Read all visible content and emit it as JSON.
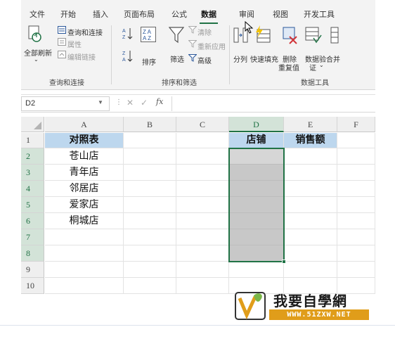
{
  "ribbon": {
    "tabs": [
      {
        "label": "文件",
        "active": false
      },
      {
        "label": "开始",
        "active": false
      },
      {
        "label": "插入",
        "active": false
      },
      {
        "label": "页面布局",
        "active": false
      },
      {
        "label": "公式",
        "active": false
      },
      {
        "label": "数据",
        "active": true
      },
      {
        "label": "审阅",
        "active": false
      },
      {
        "label": "视图",
        "active": false
      },
      {
        "label": "开发工具",
        "active": false
      }
    ],
    "query_group": {
      "refresh_all": "全部刷新",
      "queries_connections": "查询和连接",
      "properties": "属性",
      "edit_links": "编辑链接",
      "label": "查询和连接"
    },
    "sort_group": {
      "sort": "排序",
      "filter": "筛选",
      "clear": "清除",
      "reapply": "重新应用",
      "advanced": "高级",
      "label": "排序和筛选"
    },
    "tools_group": {
      "text_to_columns": "分列",
      "flash_fill": "快速填充",
      "remove_duplicates_1": "删除",
      "remove_duplicates_2": "重复值",
      "data_validation_1": "数据验",
      "data_validation_2": "证",
      "consolidate": "合并",
      "label": "数据工具"
    }
  },
  "formula_bar": {
    "name_box": "D2",
    "fx": "fx",
    "formula": ""
  },
  "sheet": {
    "columns": [
      "A",
      "B",
      "C",
      "D",
      "E",
      "F"
    ],
    "selected_column": "D",
    "rows": [
      "1",
      "2",
      "3",
      "4",
      "5",
      "6",
      "7",
      "8",
      "9",
      "10"
    ],
    "a_header": "对照表",
    "a_values": [
      "苍山店",
      "青年店",
      "邻居店",
      "爱家店",
      "桐城店"
    ],
    "d_header": "店铺",
    "e_header": "销售额"
  },
  "watermark": {
    "title": "我要自學網",
    "url": "WWW.51ZXW.NET"
  },
  "colors": {
    "accent": "#217346",
    "header_fill": "#bdd7ee",
    "selection_fill": "#c8c8c8",
    "watermark_orange": "#e09d1a"
  }
}
